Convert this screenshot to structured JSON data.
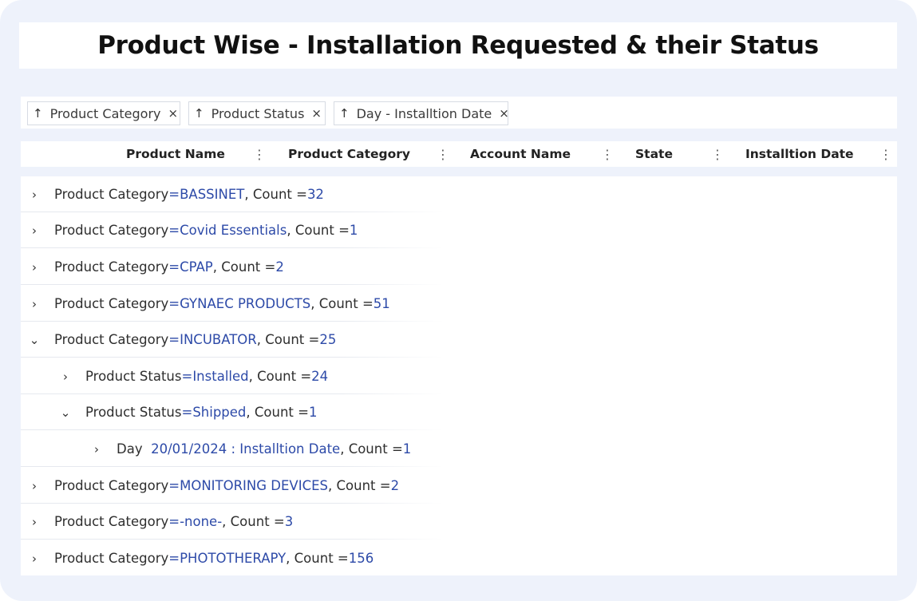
{
  "title": "Product Wise - Installation Requested & their Status",
  "group_chips": [
    {
      "arrow": "↑",
      "label": "Product Category",
      "remove": "×"
    },
    {
      "arrow": "↑",
      "label": "Product Status",
      "remove": "×"
    },
    {
      "arrow": "↑",
      "label": "Day - Installtion Date",
      "remove": "×"
    }
  ],
  "columns": [
    {
      "label": "Product Name",
      "menu": "⋮"
    },
    {
      "label": "Product Category",
      "menu": "⋮"
    },
    {
      "label": "Account Name",
      "menu": "⋮"
    },
    {
      "label": "State",
      "menu": "⋮"
    },
    {
      "label": "Installtion Date",
      "menu": "⋮"
    }
  ],
  "rows": [
    {
      "chevron": "›",
      "field": "Product Category",
      "eq": " = ",
      "value": "BASSINET",
      "count_label": ", Count = ",
      "count": "32"
    },
    {
      "chevron": "›",
      "field": "Product Category",
      "eq": " = ",
      "value": "Covid Essentials",
      "count_label": ", Count = ",
      "count": "1"
    },
    {
      "chevron": "›",
      "field": "Product Category",
      "eq": " = ",
      "value": "CPAP",
      "count_label": ", Count = ",
      "count": "2"
    },
    {
      "chevron": "›",
      "field": "Product Category",
      "eq": " = ",
      "value": "GYNAEC PRODUCTS",
      "count_label": ", Count = ",
      "count": "51"
    },
    {
      "chevron": "⌄",
      "field": "Product Category",
      "eq": " = ",
      "value": "INCUBATOR",
      "count_label": ", Count = ",
      "count": "25"
    },
    {
      "chevron": "›",
      "field": "Product Status",
      "eq": " = ",
      "value": "Installed",
      "count_label": ", Count = ",
      "count": "24"
    },
    {
      "chevron": "⌄",
      "field": "Product Status",
      "eq": " = ",
      "value": "Shipped",
      "count_label": ", Count = ",
      "count": "1"
    },
    {
      "chevron": "›",
      "field": "Day",
      "eq": "  ",
      "value": "20/01/2024 : Installtion Date",
      "count_label": ", Count = ",
      "count": "1"
    },
    {
      "chevron": "›",
      "field": "Product Category",
      "eq": " = ",
      "value": "MONITORING DEVICES",
      "count_label": ", Count = ",
      "count": "2"
    },
    {
      "chevron": "›",
      "field": "Product Category",
      "eq": " = ",
      "value": "-none-",
      "count_label": ", Count = ",
      "count": "3"
    },
    {
      "chevron": "›",
      "field": "Product Category",
      "eq": " = ",
      "value": "PHOTOTHERAPY",
      "count_label": ", Count = ",
      "count": "156"
    }
  ]
}
